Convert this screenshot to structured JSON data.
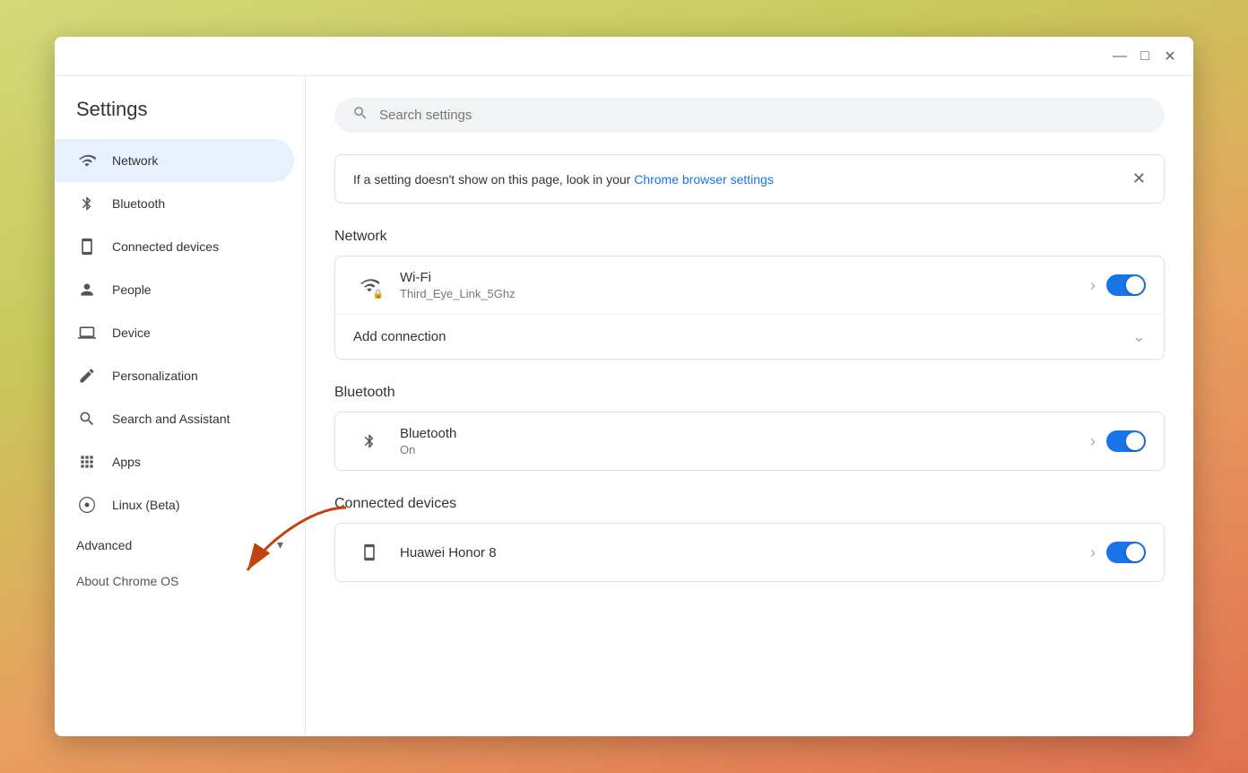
{
  "window": {
    "title": "Settings"
  },
  "titlebar": {
    "minimize": "—",
    "maximize": "□",
    "close": "✕"
  },
  "sidebar": {
    "title": "Settings",
    "items": [
      {
        "id": "network",
        "label": "Network",
        "icon": "wifi"
      },
      {
        "id": "bluetooth",
        "label": "Bluetooth",
        "icon": "bluetooth"
      },
      {
        "id": "connected-devices",
        "label": "Connected devices",
        "icon": "device"
      },
      {
        "id": "people",
        "label": "People",
        "icon": "person"
      },
      {
        "id": "device",
        "label": "Device",
        "icon": "laptop"
      },
      {
        "id": "personalization",
        "label": "Personalization",
        "icon": "pen"
      },
      {
        "id": "search-assistant",
        "label": "Search and Assistant",
        "icon": "search"
      },
      {
        "id": "apps",
        "label": "Apps",
        "icon": "apps"
      },
      {
        "id": "linux",
        "label": "Linux (Beta)",
        "icon": "linux"
      }
    ],
    "advanced_label": "Advanced",
    "about_label": "About Chrome OS"
  },
  "search": {
    "placeholder": "Search settings"
  },
  "banner": {
    "text": "If a setting doesn't show on this page, look in your ",
    "link_text": "Chrome browser settings",
    "close_icon": "✕"
  },
  "sections": {
    "network": {
      "title": "Network",
      "wifi": {
        "title": "Wi-Fi",
        "subtitle": "Third_Eye_Link_5Ghz",
        "enabled": true
      },
      "add_connection": "Add connection"
    },
    "bluetooth": {
      "title": "Bluetooth",
      "item": {
        "title": "Bluetooth",
        "subtitle": "On",
        "enabled": true
      }
    },
    "connected_devices": {
      "title": "Connected devices",
      "item": {
        "title": "Huawei Honor 8",
        "enabled": true
      }
    }
  }
}
